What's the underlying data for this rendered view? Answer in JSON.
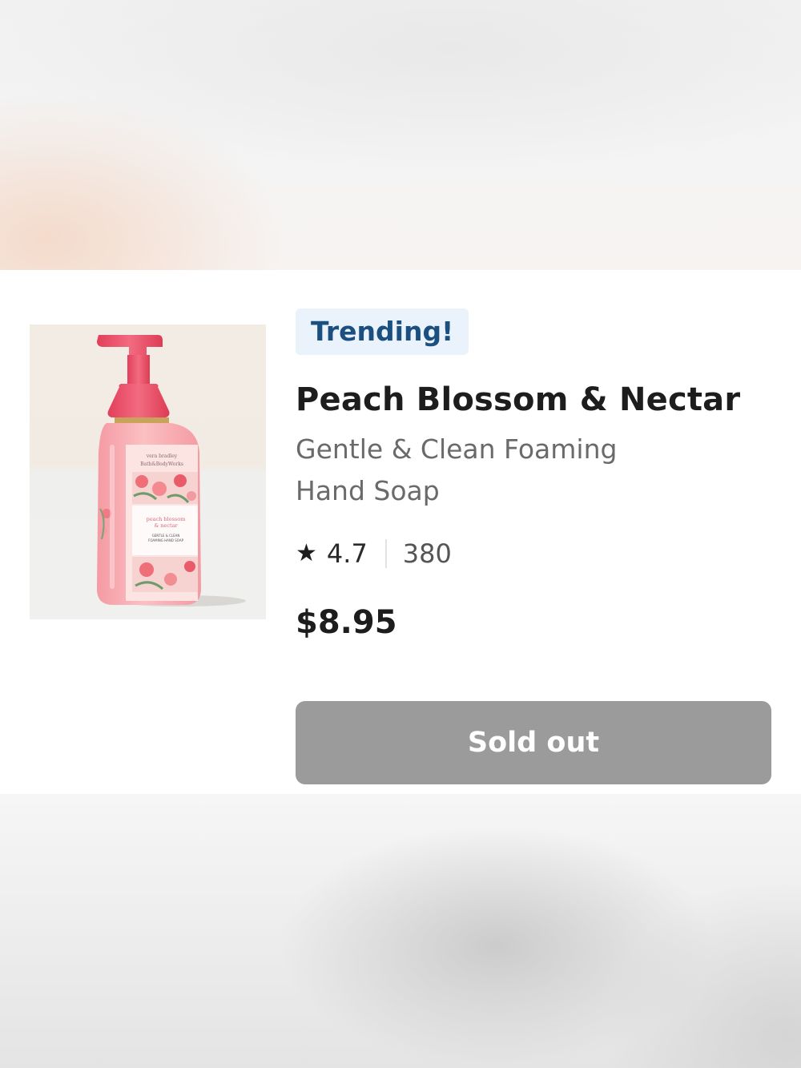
{
  "product": {
    "badge": "Trending!",
    "title": "Peach Blossom & Nectar",
    "subtitle": "Gentle & Clean Foaming Hand Soap",
    "rating": "4.7",
    "review_count": "380",
    "price": "$8.95",
    "button_label": "Sold out",
    "image": {
      "brand_text": "vera bradley & Bath&BodyWorks",
      "label_line1": "peach blossom",
      "label_line2": "& nectar",
      "label_line3": "GENTLE & CLEAN",
      "label_line4": "FOAMING HAND SOAP"
    }
  },
  "icons": {
    "rating": "star-icon"
  },
  "colors": {
    "badge_bg": "#eaf3fb",
    "badge_text": "#1a4f7f",
    "button_disabled": "#9b9b9b",
    "pump": "#e8506a",
    "bottle": "#f7a8ae"
  }
}
